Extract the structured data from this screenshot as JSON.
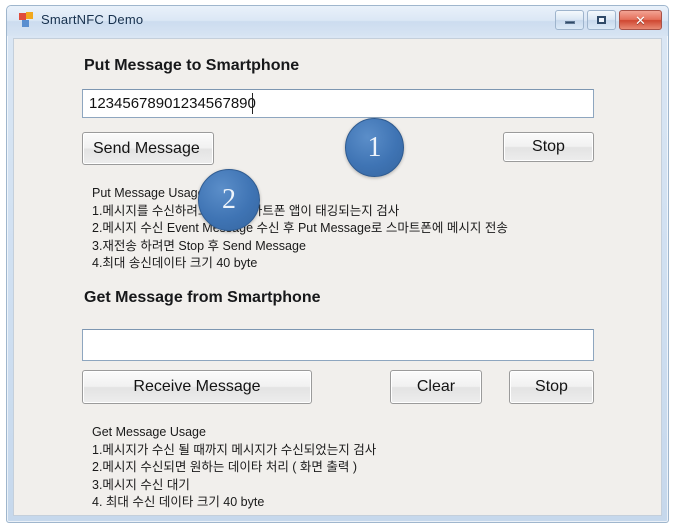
{
  "window": {
    "title": "SmartNFC Demo",
    "icon": "visual-studio-app-icon",
    "controls": {
      "minimize": "minimize-icon",
      "maximize": "maximize-icon",
      "close": "✕"
    },
    "colors": {
      "frame": "#cfdff1",
      "client_background": "#f1efec",
      "badge_blue": "#3f74b4",
      "close_red": "#cf4630"
    }
  },
  "put_section": {
    "heading": "Put Message to Smartphone",
    "input": {
      "value": "12345678901234567890",
      "placeholder": ""
    },
    "send_button": "Send Message",
    "stop_button": "Stop",
    "usage_title": "Put Message Usage",
    "usage_lines": [
      "1.메시지를 수신하려고 하는 스마트폰 앱이 태깅되는지 검사",
      "2.메시지 수신 Event Message 수신 후 Put Message로 스마트폰에 메시지 전송",
      "3.재전송 하려면 Stop 후 Send Message",
      "4.최대 송신데이타 크기 40 byte"
    ]
  },
  "get_section": {
    "heading": "Get Message from Smartphone",
    "input": {
      "value": "",
      "placeholder": ""
    },
    "receive_button": "Receive Message",
    "clear_button": "Clear",
    "stop_button": "Stop",
    "usage_title": "Get Message Usage",
    "usage_lines": [
      "1.메시지가 수신 될 때까지 메시지가 수신되었는지 검사",
      "2.메시지 수신되면 원하는 데이타 처리 ( 화면 출력 )",
      "3.메시지 수신 대기",
      "4. 최대 수신 데이타 크기 40 byte"
    ]
  },
  "annotations": {
    "badge_1": "1",
    "badge_2": "2"
  }
}
